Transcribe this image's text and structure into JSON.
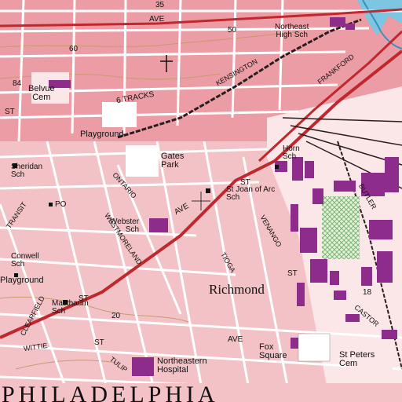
{
  "colors": {
    "urban_tint": "#f3c2c6",
    "urban_tint_dark": "#ec9ca4",
    "street": "#ffffff",
    "street_outline": "#c0737c",
    "arterial": "#c0282e",
    "railroad": "#2a1d1d",
    "building": "#8e2c8c",
    "open_space": "#ffffff",
    "park": "#f8eef0",
    "green_hatch": "#7ab870",
    "contour": "#c89a6e",
    "water": "#7cc6e2"
  },
  "icons": {
    "crosshair": "crosshair-icon",
    "school_marker": "building-marker-icon",
    "cemetery_cross": "cemetery-cross-icon"
  },
  "labels": {
    "city": "PHILADELPHIA",
    "district": "Richmond",
    "belvue_cem": [
      "Belvue",
      "Cem"
    ],
    "northeast_high_sch": [
      "Northeast",
      "High Sch"
    ],
    "gates_park": [
      "Gates",
      "Park"
    ],
    "st_joan_of_arc_sch": [
      "St Joan of Arc",
      "Sch"
    ],
    "horn_sch": [
      "Horn",
      "Sch"
    ],
    "webster_sch": [
      "Webster",
      "Sch"
    ],
    "sheridan_sch": [
      "Sheridan",
      "Sch"
    ],
    "conwell_sch": [
      "Conwell",
      "Sch"
    ],
    "masthaum_sch": [
      "Masthaum",
      "Sch"
    ],
    "playground_top": "Playground",
    "playground_left": "Playground",
    "northeastern_hospital": [
      "Northeastern",
      "Hospital"
    ],
    "fox_square": [
      "Fox",
      "Square"
    ],
    "st_peters_cem": [
      "St Peters",
      "Cem"
    ],
    "po": "PO",
    "tracks": "6 TRACKS",
    "kensington": "KENSINGTON",
    "frankford": "FRANKFORD",
    "ave_top": "AVE",
    "ave_mid": "AVE",
    "ave_lower": "AVE",
    "ave_ontario": "AVE",
    "st_a": "ST",
    "st_b": "ST",
    "st_c": "ST",
    "st_d": "ST",
    "st_e": "ST",
    "ontario": "ONTARIO",
    "westmoreland": "WESTMORELAND",
    "venango": "VENANGO",
    "tioga": "TIOGA",
    "butler": "BUTLER",
    "castor": "CASTOR",
    "clearfield": "CLEARFIELD",
    "wittie": "WITTIE",
    "tulip": "TULIP",
    "transit": "TRANSIT",
    "elev_50": "50",
    "elev_60": "60",
    "elev_84": "84",
    "elev_20": "20",
    "elev_18": "18",
    "elev_35": "35"
  }
}
